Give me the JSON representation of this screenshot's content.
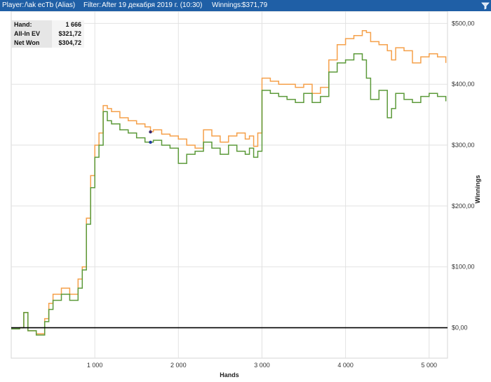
{
  "titlebar": {
    "player_label": "Player:",
    "player_name": "/\\ak ecTb (Alias)",
    "filter_label": "Filter:",
    "filter_value": "After 19 декабря 2019 г. (10:30)",
    "winnings_label": "Winnings:",
    "winnings_value": "$371,79",
    "filter_icon": "filter-funnel-icon"
  },
  "stats": [
    {
      "label": "Hand:",
      "value": "1 666"
    },
    {
      "label": "All-In EV",
      "value": "$321,72"
    },
    {
      "label": "Net Won",
      "value": "$304,72"
    }
  ],
  "colors": {
    "titlebar": "#1f5fa6",
    "allin_ev": "#f5a04a",
    "net_won": "#5c9a3a",
    "zero_line": "#000000",
    "grid": "#e2e2e2"
  },
  "chart_data": {
    "type": "line",
    "xlabel": "Hands",
    "ylabel": "Winnings",
    "xlim": [
      0,
      5220
    ],
    "ylim": [
      -50,
      520
    ],
    "x_ticks": [
      1000,
      2000,
      3000,
      4000,
      5000
    ],
    "x_tick_labels": [
      "1 000",
      "2 000",
      "3 000",
      "4 000",
      "5 000"
    ],
    "y_ticks": [
      0,
      100,
      200,
      300,
      400,
      500
    ],
    "y_tick_labels": [
      "$0,00",
      "$100,00",
      "$200,00",
      "$300,00",
      "$400,00",
      "$500,00"
    ],
    "grid": true,
    "x": [
      0,
      100,
      150,
      200,
      300,
      400,
      450,
      500,
      600,
      700,
      800,
      850,
      900,
      950,
      1000,
      1050,
      1100,
      1150,
      1200,
      1300,
      1400,
      1500,
      1600,
      1666,
      1700,
      1800,
      1900,
      2000,
      2100,
      2200,
      2300,
      2400,
      2500,
      2600,
      2700,
      2800,
      2850,
      2900,
      2950,
      3000,
      3100,
      3200,
      3300,
      3400,
      3500,
      3600,
      3700,
      3800,
      3900,
      4000,
      4100,
      4200,
      4250,
      4300,
      4400,
      4500,
      4550,
      4600,
      4700,
      4800,
      4900,
      5000,
      5100,
      5200
    ],
    "series": [
      {
        "key": "allin_ev",
        "values": [
          -2,
          0,
          25,
          -5,
          -10,
          15,
          40,
          55,
          65,
          55,
          80,
          100,
          180,
          250,
          300,
          320,
          365,
          360,
          355,
          345,
          340,
          335,
          330,
          322,
          325,
          318,
          315,
          310,
          300,
          295,
          325,
          315,
          305,
          315,
          320,
          310,
          315,
          298,
          320,
          410,
          405,
          400,
          400,
          395,
          400,
          385,
          395,
          440,
          465,
          475,
          480,
          488,
          485,
          470,
          465,
          455,
          440,
          460,
          455,
          435,
          445,
          450,
          445,
          435
        ]
      },
      {
        "key": "net_won",
        "values": [
          -2,
          0,
          25,
          -5,
          -12,
          10,
          30,
          45,
          55,
          45,
          65,
          95,
          170,
          230,
          280,
          300,
          355,
          340,
          335,
          325,
          320,
          312,
          305,
          305,
          308,
          300,
          295,
          270,
          285,
          290,
          305,
          295,
          285,
          300,
          290,
          285,
          295,
          280,
          290,
          390,
          385,
          380,
          375,
          370,
          385,
          370,
          380,
          420,
          435,
          440,
          450,
          440,
          410,
          375,
          390,
          345,
          360,
          385,
          375,
          370,
          380,
          385,
          380,
          372
        ]
      }
    ],
    "markers": [
      {
        "series": "allin_ev",
        "x": 1666,
        "y": 321.72,
        "color": "#3a2a6e"
      },
      {
        "series": "net_won",
        "x": 1666,
        "y": 304.72,
        "color": "#1f3aa0"
      }
    ]
  }
}
